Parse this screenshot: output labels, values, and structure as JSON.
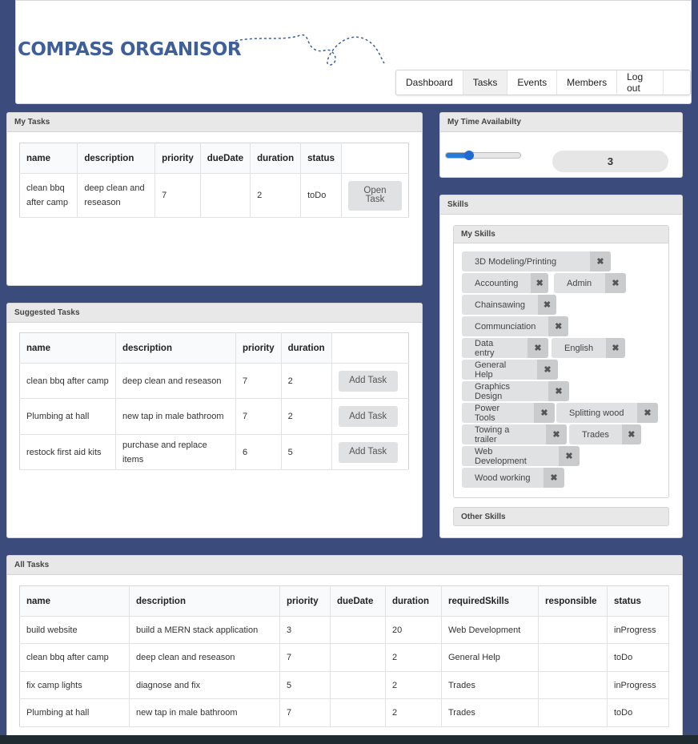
{
  "header": {
    "logo": "COMPASS ORGANISOR",
    "nav": [
      "Dashboard",
      "Tasks",
      "Events",
      "Members",
      "Log out"
    ],
    "active_nav": "Tasks"
  },
  "my_tasks": {
    "title": "My Tasks",
    "columns": [
      "name",
      "description",
      "priority",
      "dueDate",
      "duration",
      "status"
    ],
    "rows": [
      {
        "name": "clean bbq after camp",
        "description": "deep clean and reseason",
        "priority": "7",
        "dueDate": "",
        "duration": "2",
        "status": "toDo",
        "action": "Open Task"
      }
    ]
  },
  "time": {
    "title": "My Time Availabilty",
    "slider_fraction": 0.3,
    "value": "3"
  },
  "suggested": {
    "title": "Suggested Tasks",
    "columns": [
      "name",
      "description",
      "priority",
      "duration"
    ],
    "rows": [
      {
        "name": "clean bbq after camp",
        "description": "deep clean and reseason",
        "priority": "7",
        "duration": "2",
        "action": "Add Task"
      },
      {
        "name": "Plumbing at hall",
        "description": "new tap in male bathroom",
        "priority": "7",
        "duration": "2",
        "action": "Add Task"
      },
      {
        "name": "restock first aid kits",
        "description": "purchase and replace items",
        "priority": "6",
        "duration": "5",
        "action": "Add Task"
      }
    ]
  },
  "skills": {
    "title": "Skills",
    "my_skills_title": "My Skills",
    "other_skills_title": "Other Skills",
    "remove_icon": "✖",
    "items": [
      "3D Modeling/Printing",
      "Accounting",
      "Admin",
      "Chainsawing",
      "Communciation",
      "Data entry",
      "English",
      "General Help",
      "Graphics Design",
      "Power Tools",
      "Splitting wood",
      "Towing a trailer",
      "Trades",
      "Web Development",
      "Wood working"
    ]
  },
  "all_tasks": {
    "title": "All Tasks",
    "columns": [
      "name",
      "description",
      "priority",
      "dueDate",
      "duration",
      "requiredSkills",
      "responsible",
      "status"
    ],
    "rows": [
      {
        "name": "build website",
        "description": "build a MERN stack application",
        "priority": "3",
        "dueDate": "",
        "duration": "20",
        "requiredSkills": "Web Development",
        "responsible": "",
        "status": "inProgress"
      },
      {
        "name": "clean bbq after camp",
        "description": "deep clean and reseason",
        "priority": "7",
        "dueDate": "",
        "duration": "2",
        "requiredSkills": "General Help",
        "responsible": "",
        "status": "toDo"
      },
      {
        "name": "fix camp lights",
        "description": "diagnose and fix",
        "priority": "5",
        "dueDate": "",
        "duration": "2",
        "requiredSkills": "Trades",
        "responsible": "",
        "status": "inProgress"
      },
      {
        "name": "Plumbing at hall",
        "description": "new tap in male bathroom",
        "priority": "7",
        "dueDate": "",
        "duration": "2",
        "requiredSkills": "Trades",
        "responsible": "",
        "status": "toDo"
      }
    ]
  },
  "colors": {
    "background": "#3a4b7c",
    "accent": "#2979d6",
    "logo": "#3f5f9a"
  }
}
